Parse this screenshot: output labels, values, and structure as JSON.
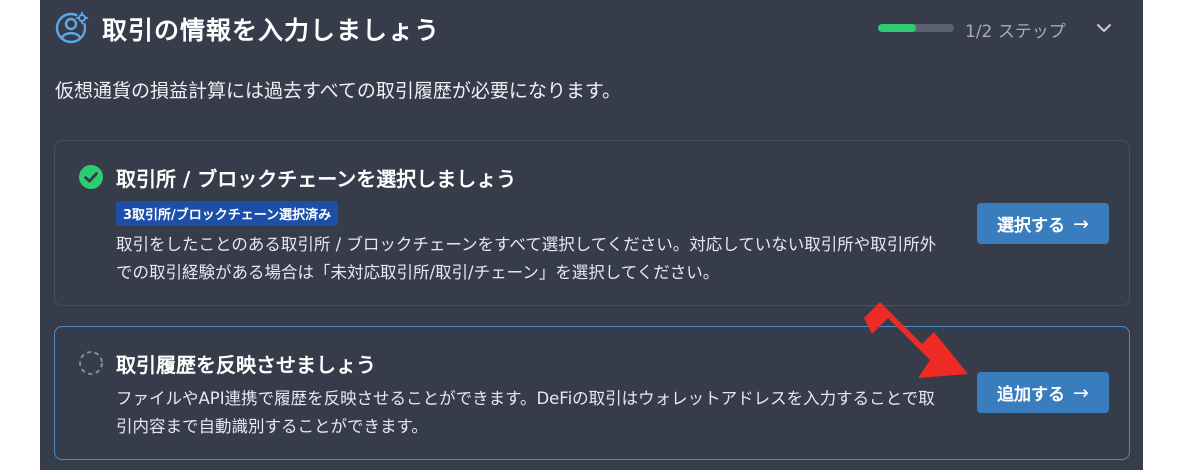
{
  "header": {
    "icon": "user-settings-icon",
    "title": "取引の情報を入力しましょう",
    "progress": {
      "value": 0.5,
      "label": "1/2 ステップ",
      "color": "#2ecc71"
    },
    "toggle_icon": "chevron-down-icon"
  },
  "subtitle": "仮想通貨の損益計算には過去すべての取引履歴が必要になります。",
  "cards": [
    {
      "status": "completed",
      "status_icon": "check-circle-icon",
      "title": "取引所 / ブロックチェーンを選択しましょう",
      "badge": "3取引所/ブロックチェーン選択済み",
      "description": "取引をしたことのある取引所 / ブロックチェーンをすべて選択してください。対応していない取引所や取引所外での取引経験がある場合は「未対応取引所/取引/チェーン」を選択してください。",
      "button": {
        "label": "選択する",
        "arrow": "→"
      }
    },
    {
      "status": "pending",
      "status_icon": "dashed-circle-icon",
      "title": "取引履歴を反映させましょう",
      "description": "ファイルやAPI連携で履歴を反映させることができます。DeFiの取引はウォレットアドレスを入力することで取引内容まで自動識別することができます。",
      "button": {
        "label": "追加する",
        "arrow": "→"
      }
    }
  ],
  "annotation": {
    "icon": "red-arrow-icon",
    "color": "#ee2a24"
  },
  "colors": {
    "panel_bg": "#373c4b",
    "accent_blue": "#3a7dbe",
    "badge_blue": "#1d4fa8",
    "success_green": "#2ecc71",
    "active_border": "#4d8bc8"
  }
}
